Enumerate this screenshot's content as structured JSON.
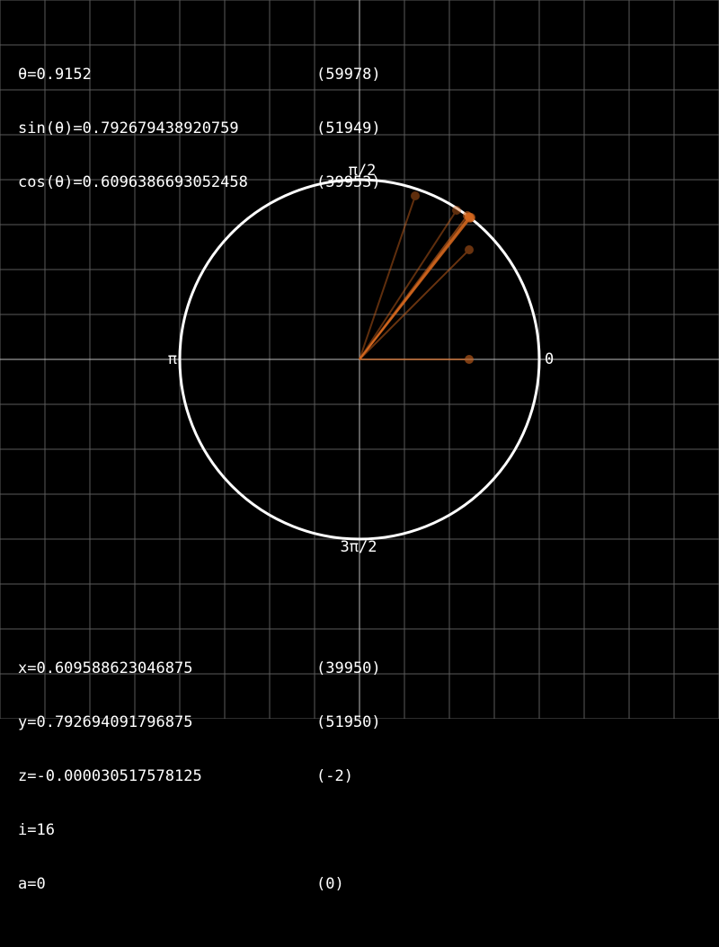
{
  "readout_top": [
    {
      "text": "θ=0.9152",
      "raw": "(59978)"
    },
    {
      "text": "sin(θ)=0.792679438920759",
      "raw": "(51949)"
    },
    {
      "text": "cos(θ)=0.6096386693052458",
      "raw": "(39953)"
    }
  ],
  "readout_bottom": [
    {
      "text": "x=0.609588623046875",
      "raw": "(39950)"
    },
    {
      "text": "y=0.79269409179687​5",
      "raw": "(51950)"
    },
    {
      "text": "z=-0.000030517578125",
      "raw": "(-2)"
    },
    {
      "text": "i=16",
      "raw": ""
    },
    {
      "text": "a=0",
      "raw": "(0)"
    }
  ],
  "circle_labels": {
    "right": "0",
    "top": "π/2",
    "left": "π",
    "bottom": "3π/2"
  },
  "colors": {
    "background": "#000000",
    "grid": "#5a5a5a",
    "axis": "#bbbbbb",
    "circle": "#ffffff",
    "vector": "#d2661e"
  },
  "chart_data": {
    "type": "scatter",
    "x_range": [
      -1,
      1
    ],
    "y_range": [
      -1,
      1
    ],
    "grid": true,
    "unit_circle": true,
    "vectors": [
      {
        "x": 0.61,
        "y": 0.0,
        "opacity": 0.6
      },
      {
        "x": 0.31,
        "y": 0.91,
        "opacity": 0.45
      },
      {
        "x": 0.54,
        "y": 0.83,
        "opacity": 0.45
      },
      {
        "x": 0.61,
        "y": 0.61,
        "opacity": 0.5
      },
      {
        "x": 0.6,
        "y": 0.8,
        "opacity": 0.6
      },
      {
        "x": 0.62,
        "y": 0.79,
        "opacity": 0.65
      },
      {
        "x": 0.615,
        "y": 0.786,
        "opacity": 0.7
      },
      {
        "x": 0.6096,
        "y": 0.7927,
        "opacity": 0.9
      }
    ]
  }
}
